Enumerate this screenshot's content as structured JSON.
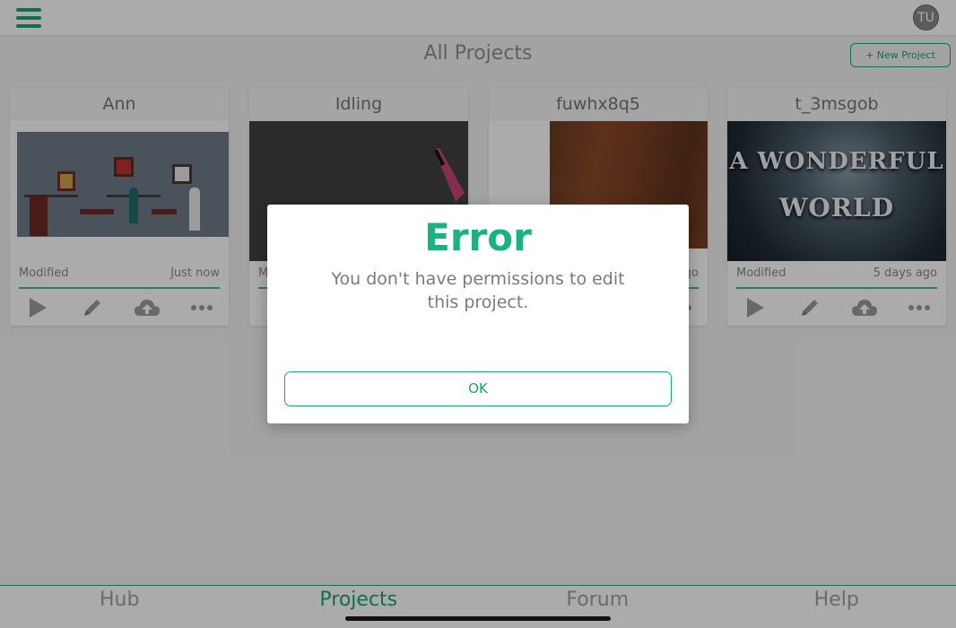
{
  "header": {
    "menu_icon": "hamburger-menu-icon",
    "avatar_initials": "TU",
    "page_title": "All Projects",
    "new_project_label": "+ New Project"
  },
  "projects": [
    {
      "name": "Ann",
      "modified_label": "Modified",
      "modified_time": "Just now",
      "thumbnail": "office-scene"
    },
    {
      "name": "Idling",
      "modified_label": "Mo",
      "modified_time": "",
      "thumbnail": "dark-scene"
    },
    {
      "name": "fuwhx8q5",
      "modified_label": "",
      "modified_time": "go",
      "thumbnail": "wood-scene"
    },
    {
      "name": "t_3msgob",
      "modified_label": "Modified",
      "modified_time": "5 days ago",
      "thumbnail": "wonderful-world",
      "thumbnail_text": [
        "A WONDERFUL",
        "WORLD"
      ]
    }
  ],
  "card_actions": [
    "play-icon",
    "edit-pencil-icon",
    "cloud-upload-icon",
    "more-dots-icon"
  ],
  "tabs": [
    {
      "label": "Hub",
      "active": false
    },
    {
      "label": "Projects",
      "active": true
    },
    {
      "label": "Forum",
      "active": false
    },
    {
      "label": "Help",
      "active": false
    }
  ],
  "dialog": {
    "title": "Error",
    "message": "You don't have permissions to edit this project.",
    "ok_label": "OK"
  },
  "colors": {
    "accent": "#1ba37a",
    "error_title": "#1cb27f",
    "overlay": "rgba(0,0,0,0.33)"
  }
}
